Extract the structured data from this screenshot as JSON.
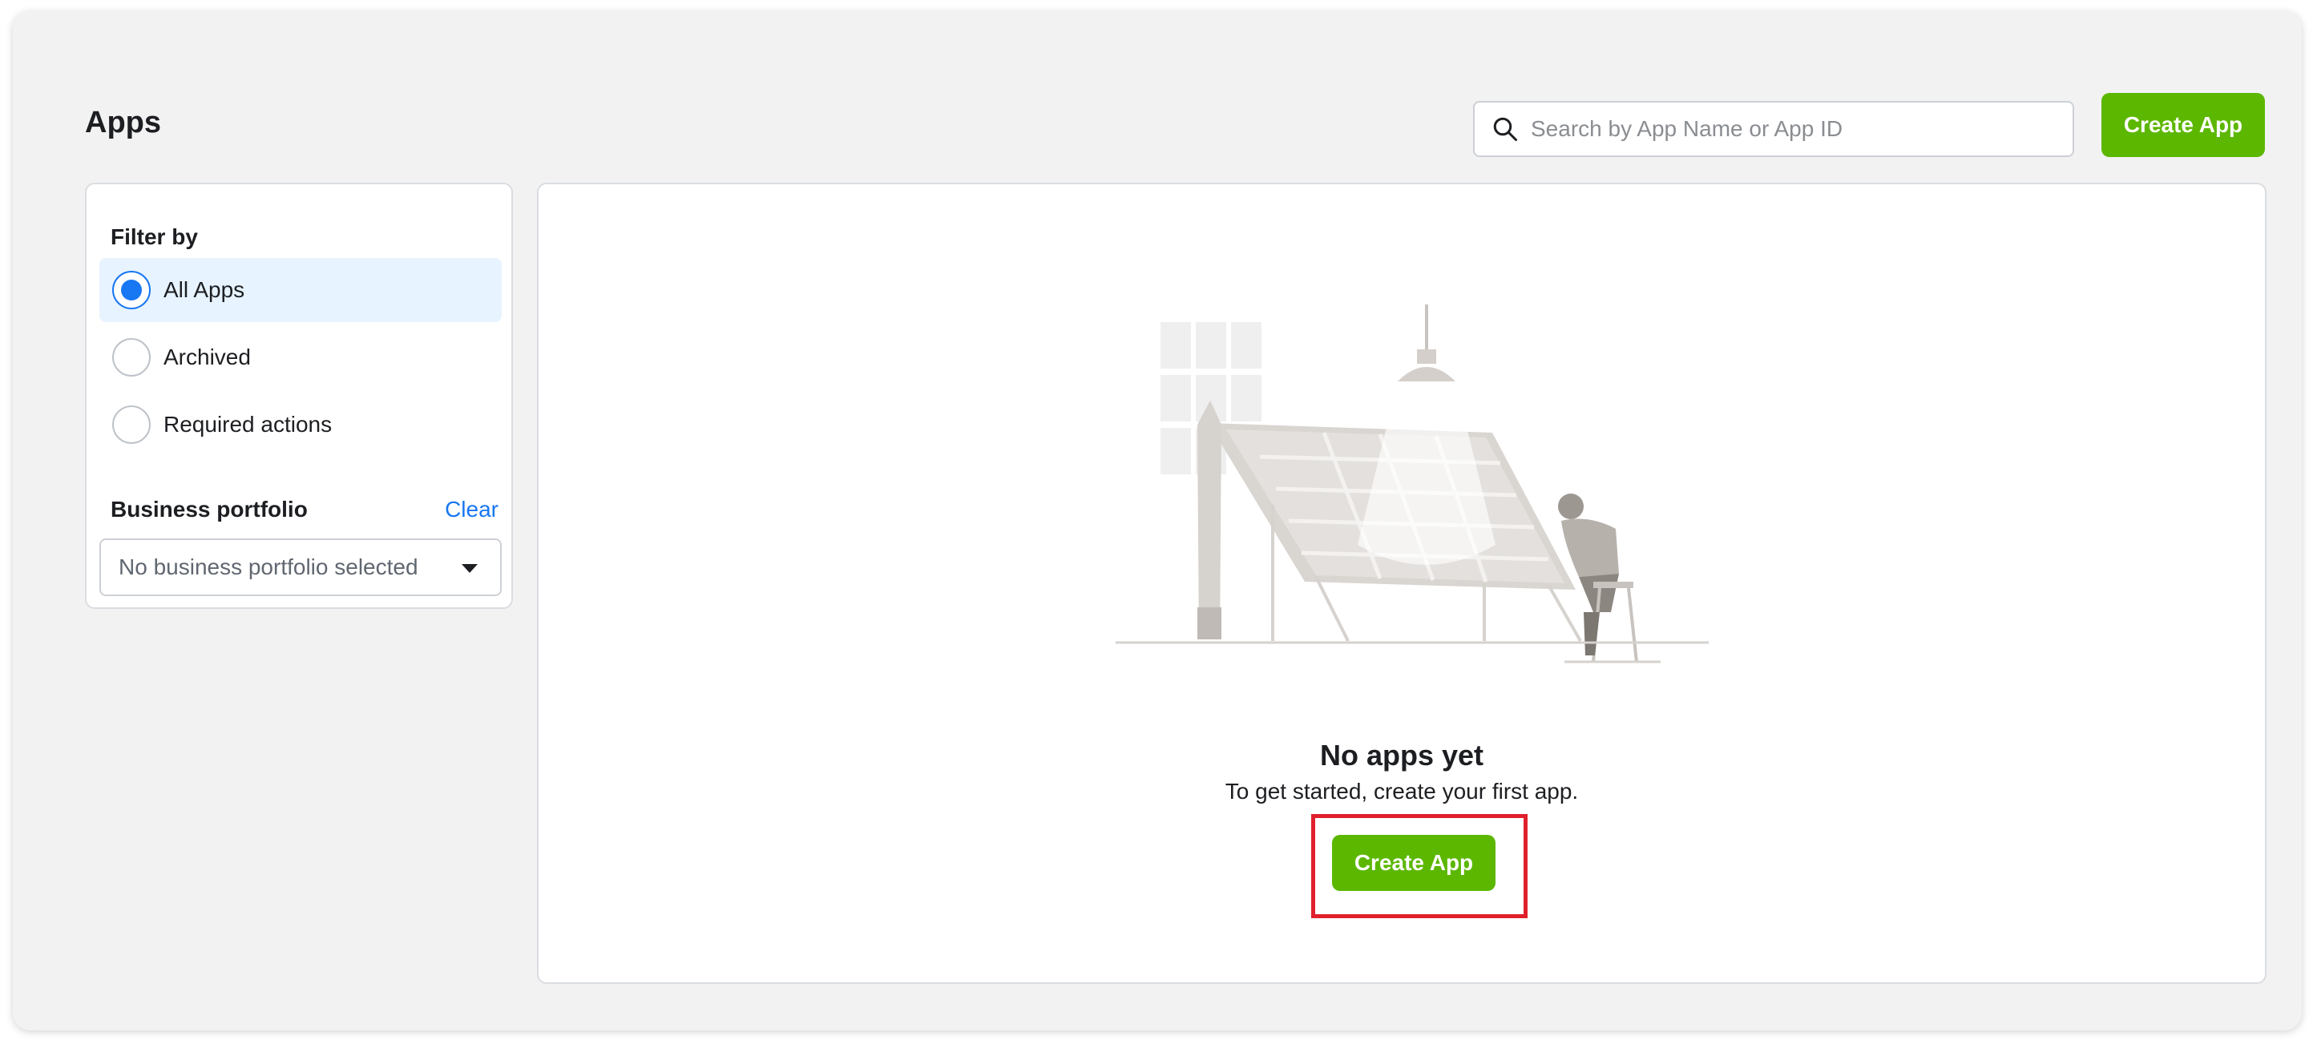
{
  "page": {
    "title": "Apps"
  },
  "search": {
    "placeholder": "Search by App Name or App ID",
    "icon": "search-icon"
  },
  "header": {
    "create_label": "Create App"
  },
  "filter": {
    "title": "Filter by",
    "options": [
      {
        "label": "All Apps",
        "selected": true
      },
      {
        "label": "Archived",
        "selected": false
      },
      {
        "label": "Required actions",
        "selected": false
      }
    ],
    "business_portfolio": {
      "title": "Business portfolio",
      "clear_label": "Clear",
      "select_value": "No business portfolio selected"
    }
  },
  "empty_state": {
    "title": "No apps yet",
    "subtitle": "To get started, create your first app.",
    "create_label": "Create App"
  },
  "colors": {
    "accent": "#5cb700",
    "link": "#1877f2",
    "selected_bg": "#e7f3ff",
    "highlight": "#e0202c"
  }
}
